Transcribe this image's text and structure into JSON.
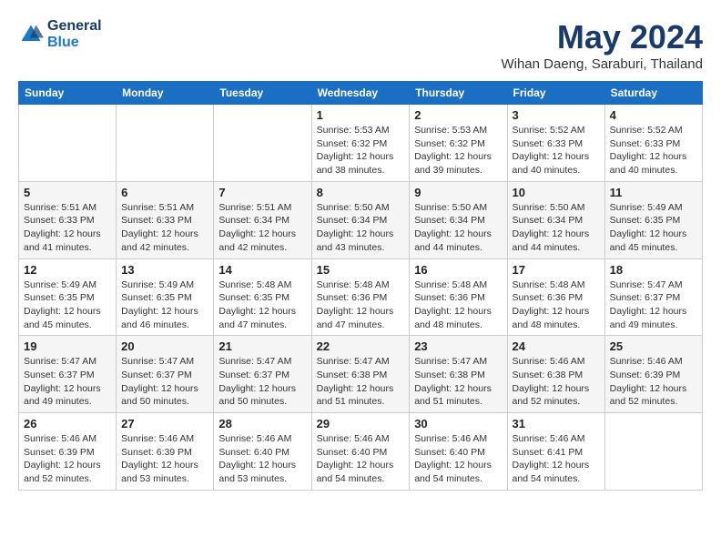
{
  "logo": {
    "line1": "General",
    "line2": "Blue"
  },
  "title": {
    "month_year": "May 2024",
    "location": "Wihan Daeng, Saraburi, Thailand"
  },
  "weekdays": [
    "Sunday",
    "Monday",
    "Tuesday",
    "Wednesday",
    "Thursday",
    "Friday",
    "Saturday"
  ],
  "weeks": [
    [
      {
        "day": "",
        "info": ""
      },
      {
        "day": "",
        "info": ""
      },
      {
        "day": "",
        "info": ""
      },
      {
        "day": "1",
        "info": "Sunrise: 5:53 AM\nSunset: 6:32 PM\nDaylight: 12 hours\nand 38 minutes."
      },
      {
        "day": "2",
        "info": "Sunrise: 5:53 AM\nSunset: 6:32 PM\nDaylight: 12 hours\nand 39 minutes."
      },
      {
        "day": "3",
        "info": "Sunrise: 5:52 AM\nSunset: 6:33 PM\nDaylight: 12 hours\nand 40 minutes."
      },
      {
        "day": "4",
        "info": "Sunrise: 5:52 AM\nSunset: 6:33 PM\nDaylight: 12 hours\nand 40 minutes."
      }
    ],
    [
      {
        "day": "5",
        "info": "Sunrise: 5:51 AM\nSunset: 6:33 PM\nDaylight: 12 hours\nand 41 minutes."
      },
      {
        "day": "6",
        "info": "Sunrise: 5:51 AM\nSunset: 6:33 PM\nDaylight: 12 hours\nand 42 minutes."
      },
      {
        "day": "7",
        "info": "Sunrise: 5:51 AM\nSunset: 6:34 PM\nDaylight: 12 hours\nand 42 minutes."
      },
      {
        "day": "8",
        "info": "Sunrise: 5:50 AM\nSunset: 6:34 PM\nDaylight: 12 hours\nand 43 minutes."
      },
      {
        "day": "9",
        "info": "Sunrise: 5:50 AM\nSunset: 6:34 PM\nDaylight: 12 hours\nand 44 minutes."
      },
      {
        "day": "10",
        "info": "Sunrise: 5:50 AM\nSunset: 6:34 PM\nDaylight: 12 hours\nand 44 minutes."
      },
      {
        "day": "11",
        "info": "Sunrise: 5:49 AM\nSunset: 6:35 PM\nDaylight: 12 hours\nand 45 minutes."
      }
    ],
    [
      {
        "day": "12",
        "info": "Sunrise: 5:49 AM\nSunset: 6:35 PM\nDaylight: 12 hours\nand 45 minutes."
      },
      {
        "day": "13",
        "info": "Sunrise: 5:49 AM\nSunset: 6:35 PM\nDaylight: 12 hours\nand 46 minutes."
      },
      {
        "day": "14",
        "info": "Sunrise: 5:48 AM\nSunset: 6:35 PM\nDaylight: 12 hours\nand 47 minutes."
      },
      {
        "day": "15",
        "info": "Sunrise: 5:48 AM\nSunset: 6:36 PM\nDaylight: 12 hours\nand 47 minutes."
      },
      {
        "day": "16",
        "info": "Sunrise: 5:48 AM\nSunset: 6:36 PM\nDaylight: 12 hours\nand 48 minutes."
      },
      {
        "day": "17",
        "info": "Sunrise: 5:48 AM\nSunset: 6:36 PM\nDaylight: 12 hours\nand 48 minutes."
      },
      {
        "day": "18",
        "info": "Sunrise: 5:47 AM\nSunset: 6:37 PM\nDaylight: 12 hours\nand 49 minutes."
      }
    ],
    [
      {
        "day": "19",
        "info": "Sunrise: 5:47 AM\nSunset: 6:37 PM\nDaylight: 12 hours\nand 49 minutes."
      },
      {
        "day": "20",
        "info": "Sunrise: 5:47 AM\nSunset: 6:37 PM\nDaylight: 12 hours\nand 50 minutes."
      },
      {
        "day": "21",
        "info": "Sunrise: 5:47 AM\nSunset: 6:37 PM\nDaylight: 12 hours\nand 50 minutes."
      },
      {
        "day": "22",
        "info": "Sunrise: 5:47 AM\nSunset: 6:38 PM\nDaylight: 12 hours\nand 51 minutes."
      },
      {
        "day": "23",
        "info": "Sunrise: 5:47 AM\nSunset: 6:38 PM\nDaylight: 12 hours\nand 51 minutes."
      },
      {
        "day": "24",
        "info": "Sunrise: 5:46 AM\nSunset: 6:38 PM\nDaylight: 12 hours\nand 52 minutes."
      },
      {
        "day": "25",
        "info": "Sunrise: 5:46 AM\nSunset: 6:39 PM\nDaylight: 12 hours\nand 52 minutes."
      }
    ],
    [
      {
        "day": "26",
        "info": "Sunrise: 5:46 AM\nSunset: 6:39 PM\nDaylight: 12 hours\nand 52 minutes."
      },
      {
        "day": "27",
        "info": "Sunrise: 5:46 AM\nSunset: 6:39 PM\nDaylight: 12 hours\nand 53 minutes."
      },
      {
        "day": "28",
        "info": "Sunrise: 5:46 AM\nSunset: 6:40 PM\nDaylight: 12 hours\nand 53 minutes."
      },
      {
        "day": "29",
        "info": "Sunrise: 5:46 AM\nSunset: 6:40 PM\nDaylight: 12 hours\nand 54 minutes."
      },
      {
        "day": "30",
        "info": "Sunrise: 5:46 AM\nSunset: 6:40 PM\nDaylight: 12 hours\nand 54 minutes."
      },
      {
        "day": "31",
        "info": "Sunrise: 5:46 AM\nSunset: 6:41 PM\nDaylight: 12 hours\nand 54 minutes."
      },
      {
        "day": "",
        "info": ""
      }
    ]
  ]
}
